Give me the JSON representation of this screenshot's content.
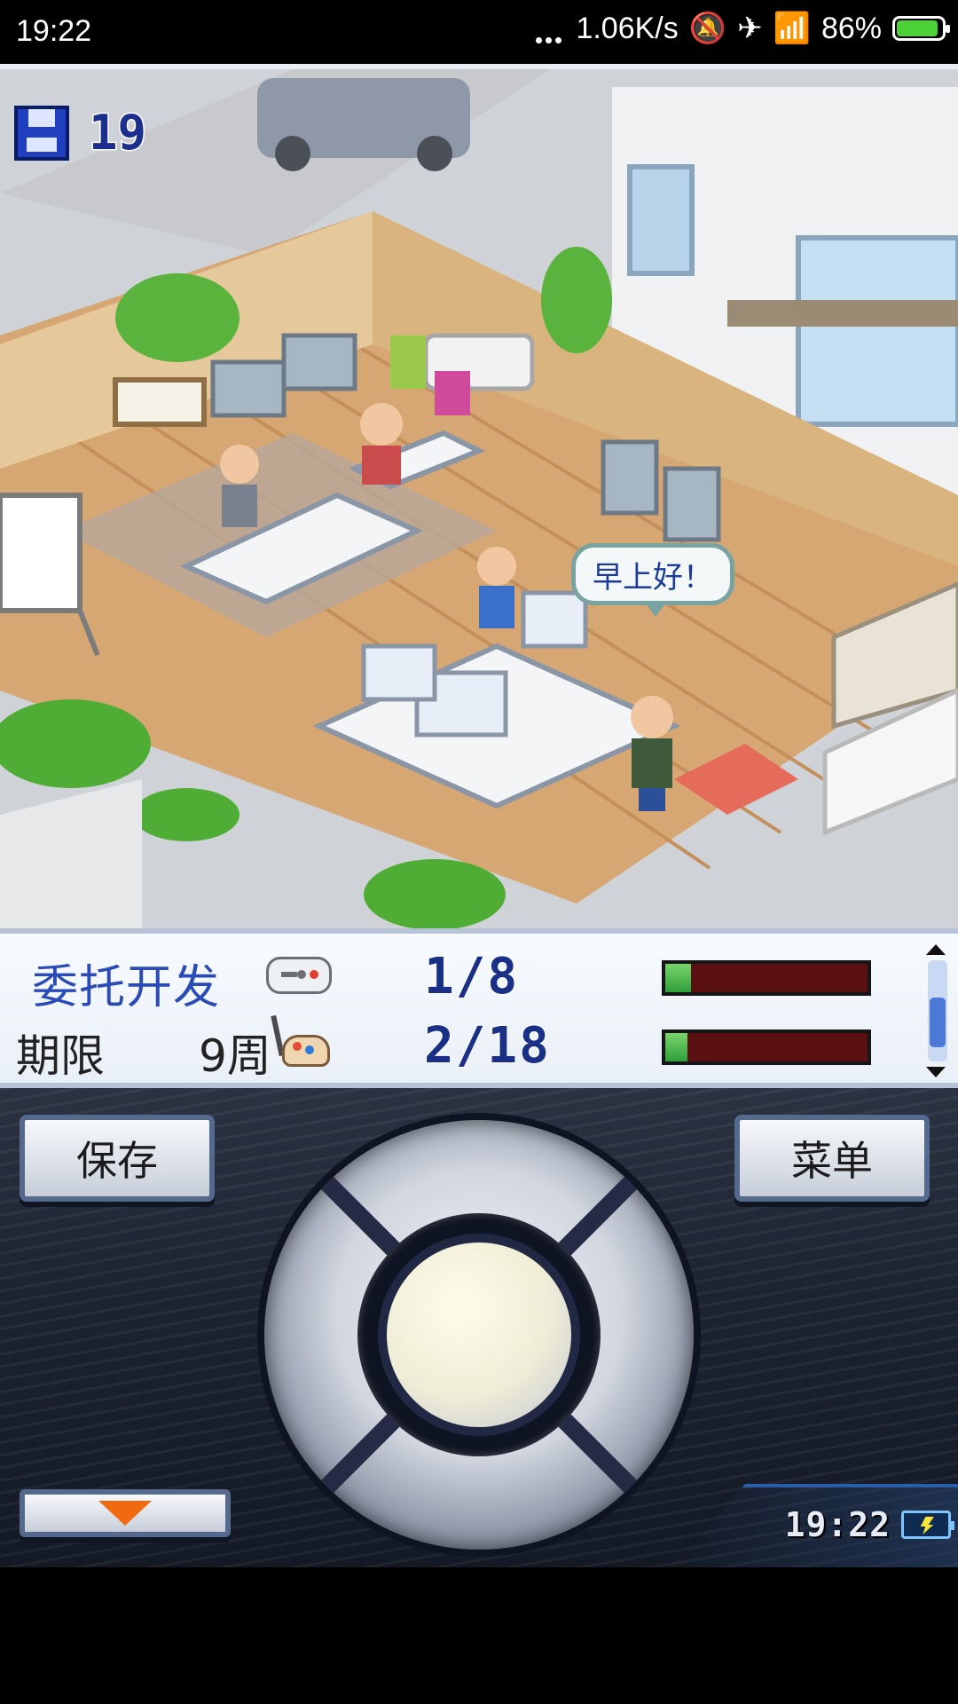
{
  "status_bar": {
    "time": "19:22",
    "network_speed": "1.06K/s",
    "battery_percent": "86%",
    "icons": [
      "dots-icon",
      "mute-icon",
      "airplane-icon",
      "wifi-icon",
      "battery-charging-icon"
    ],
    "battery_level": 0.86
  },
  "game": {
    "save_count": "19",
    "speech": "早上好！",
    "info": {
      "job_name": "委托开发",
      "deadline_label": "期限",
      "deadline_value": "9周",
      "progress_rows": [
        {
          "icon": "gamepad-icon",
          "text": "1/8",
          "fraction": 0.125
        },
        {
          "icon": "palette-icon",
          "text": "2/18",
          "fraction": 0.111
        }
      ]
    },
    "controls": {
      "save_label": "保存",
      "menu_label": "菜单",
      "down_icon": "down-triangle-icon",
      "clock": "19:22",
      "battery_icon": "battery-charging-icon"
    },
    "colors": {
      "bar_fill": "#2ea03a",
      "bar_bg": "#5a1010",
      "text_blue": "#2a4bb6"
    }
  }
}
